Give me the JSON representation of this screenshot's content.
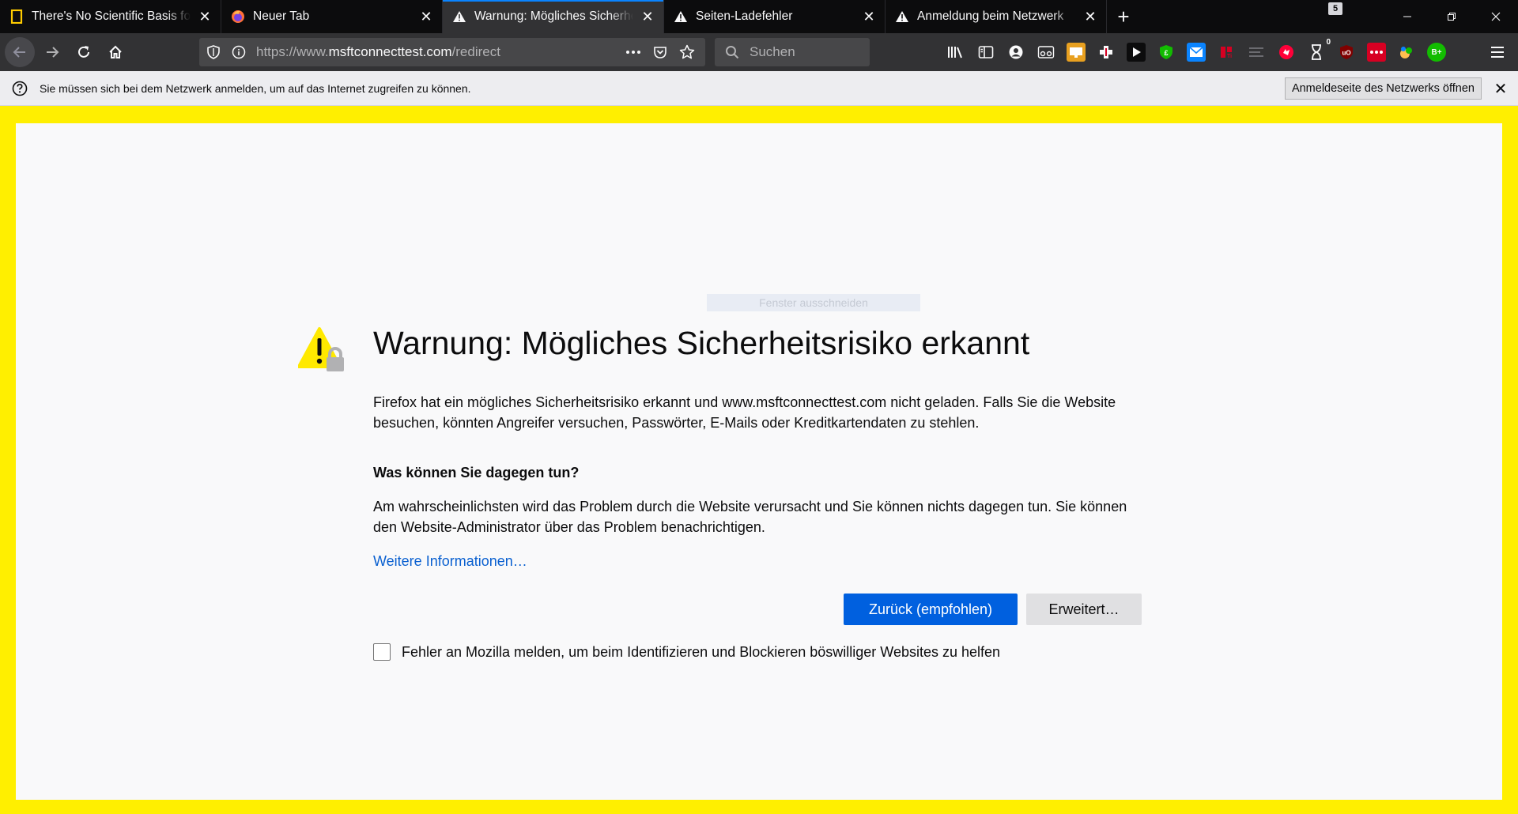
{
  "tabs": [
    {
      "title": "There's No Scientific Basis for R",
      "icon": "bookmark-icon",
      "active": false
    },
    {
      "title": "Neuer Tab",
      "icon": "firefox-icon",
      "active": false
    },
    {
      "title": "Warnung: Mögliches Sicherheitsrisiko",
      "icon": "warning-icon",
      "active": true
    },
    {
      "title": "Seiten-Ladefehler",
      "icon": "warning-icon",
      "active": false
    },
    {
      "title": "Anmeldung beim Netzwerk",
      "icon": "warning-icon",
      "active": false
    }
  ],
  "window": {
    "tab_count_badge": "5"
  },
  "urlbar": {
    "prefix": "https://www.",
    "host": "msftconnecttest.com",
    "path": "/redirect"
  },
  "searchbar": {
    "placeholder": "Suchen"
  },
  "extensions": [
    "library-icon",
    "sidebar-icon",
    "account-icon",
    "reader-glasses-icon",
    "screenshot-icon",
    "plus-cross-icon",
    "play-icon",
    "shield-extension-icon",
    "mail-icon",
    "extension-red-icon",
    "feed-icon",
    "red-circle-icon",
    "timer-icon",
    "ublock-icon",
    "dots-red-icon",
    "paint-icon",
    "b-plus-icon"
  ],
  "extension_badges": {
    "timer": "0"
  },
  "notification": {
    "text": "Sie müssen sich bei dem Netzwerk anmelden, um auf das Internet zugreifen zu können.",
    "button_label": "Anmeldeseite des Netzwerks öffnen"
  },
  "overlay": {
    "snip_label": "Fenster ausschneiden"
  },
  "error_page": {
    "title": "Warnung: Mögliches Sicherheitsrisiko erkannt",
    "description": "Firefox hat ein mögliches Sicherheitsrisiko erkannt und www.msftconnecttest.com nicht geladen. Falls Sie die Website besuchen, könnten Angreifer versuchen, Passwörter, E-Mails oder Kreditkartendaten zu stehlen.",
    "subheading": "Was können Sie dagegen tun?",
    "advice": "Am wahrscheinlichsten wird das Problem durch die Website verursacht und Sie können nichts dagegen tun. Sie können den Website-Administrator über das Problem benachrichtigen.",
    "learn_more": "Weitere Informationen…",
    "primary_button": "Zurück (empfohlen)",
    "secondary_button": "Erweitert…",
    "report_label": "Fehler an Mozilla melden, um beim Identifizieren und Blockieren böswilliger Websites zu helfen",
    "report_checked": false
  },
  "colors": {
    "accent": "#0060df",
    "border_highlight": "#ffef00",
    "link": "#0a60d0",
    "warning": "#ffe900"
  }
}
